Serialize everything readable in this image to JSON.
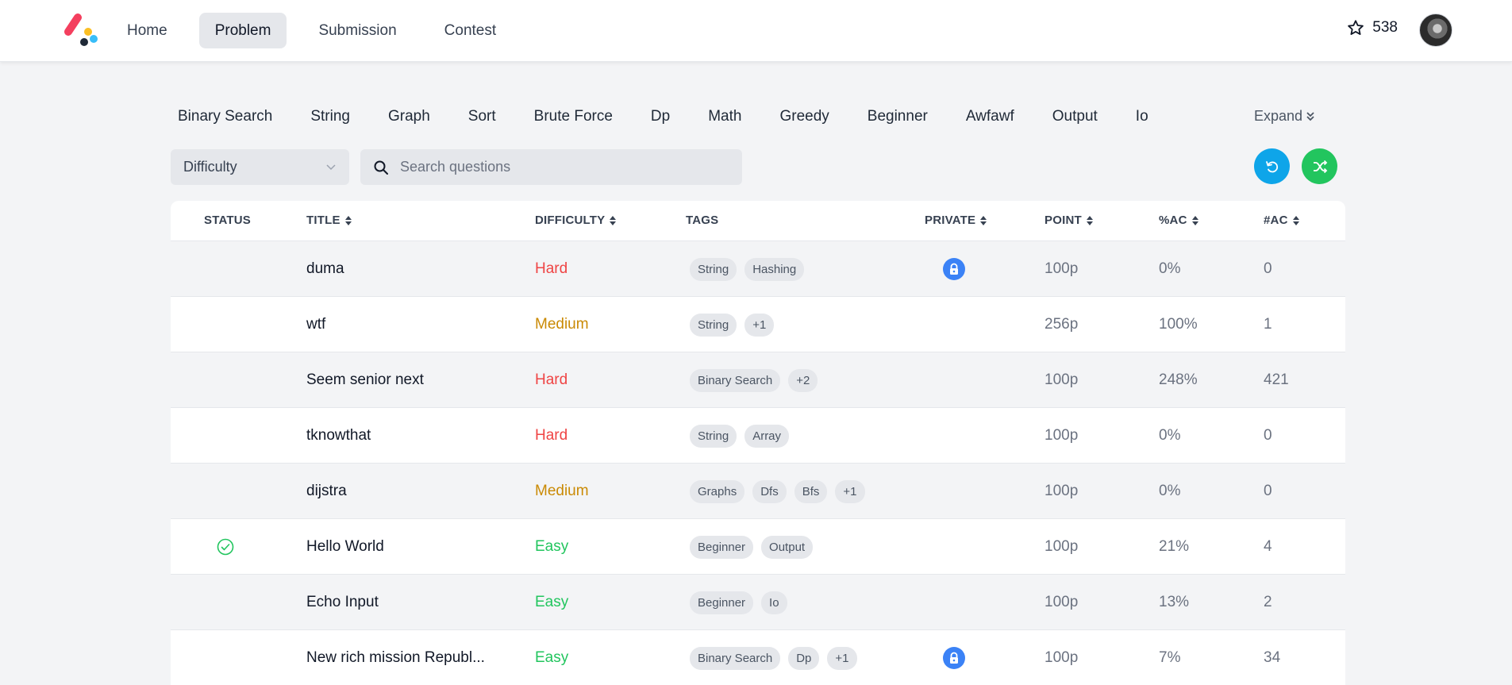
{
  "nav": {
    "items": [
      {
        "label": "Home",
        "active": false
      },
      {
        "label": "Problem",
        "active": true
      },
      {
        "label": "Submission",
        "active": false
      },
      {
        "label": "Contest",
        "active": false
      }
    ],
    "points": "538"
  },
  "tag_filters": [
    "Binary Search",
    "String",
    "Graph",
    "Sort",
    "Brute Force",
    "Dp",
    "Math",
    "Greedy",
    "Beginner",
    "Awfawf",
    "Output",
    "Io"
  ],
  "expand_label": "Expand",
  "controls": {
    "difficulty_label": "Difficulty",
    "search_placeholder": "Search questions"
  },
  "table": {
    "headers": {
      "status": "STATUS",
      "title": "TITLE",
      "difficulty": "DIFFICULTY",
      "tags": "TAGS",
      "private": "PRIVATE",
      "point": "POINT",
      "pct_ac": "%AC",
      "num_ac": "#AC"
    },
    "rows": [
      {
        "status": "",
        "title": "duma",
        "difficulty": "Hard",
        "tags": [
          "String",
          "Hashing"
        ],
        "private": true,
        "point": "100p",
        "pct_ac": "0%",
        "num_ac": "0"
      },
      {
        "status": "",
        "title": "wtf",
        "difficulty": "Medium",
        "tags": [
          "String",
          "+1"
        ],
        "private": false,
        "point": "256p",
        "pct_ac": "100%",
        "num_ac": "1"
      },
      {
        "status": "",
        "title": "Seem senior next",
        "difficulty": "Hard",
        "tags": [
          "Binary Search",
          "+2"
        ],
        "private": false,
        "point": "100p",
        "pct_ac": "248%",
        "num_ac": "421"
      },
      {
        "status": "",
        "title": "tknowthat",
        "difficulty": "Hard",
        "tags": [
          "String",
          "Array"
        ],
        "private": false,
        "point": "100p",
        "pct_ac": "0%",
        "num_ac": "0"
      },
      {
        "status": "",
        "title": "dijstra",
        "difficulty": "Medium",
        "tags": [
          "Graphs",
          "Dfs",
          "Bfs",
          "+1"
        ],
        "private": false,
        "point": "100p",
        "pct_ac": "0%",
        "num_ac": "0"
      },
      {
        "status": "solved",
        "title": "Hello World",
        "difficulty": "Easy",
        "tags": [
          "Beginner",
          "Output"
        ],
        "private": false,
        "point": "100p",
        "pct_ac": "21%",
        "num_ac": "4"
      },
      {
        "status": "",
        "title": "Echo Input",
        "difficulty": "Easy",
        "tags": [
          "Beginner",
          "Io"
        ],
        "private": false,
        "point": "100p",
        "pct_ac": "13%",
        "num_ac": "2"
      },
      {
        "status": "",
        "title": "New rich mission Republ...",
        "difficulty": "Easy",
        "tags": [
          "Binary Search",
          "Dp",
          "+1"
        ],
        "private": true,
        "point": "100p",
        "pct_ac": "7%",
        "num_ac": "34"
      }
    ]
  },
  "colors": {
    "hard": "#ef4444",
    "medium": "#ca8a04",
    "easy": "#22c55e",
    "refresh_button": "#0ea5e9",
    "shuffle_button": "#22c55e",
    "lock": "#3b82f6"
  }
}
